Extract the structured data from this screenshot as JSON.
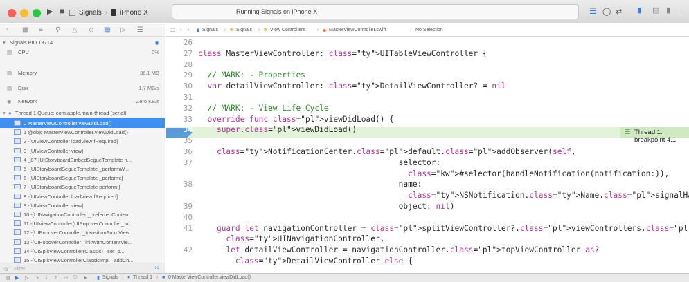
{
  "toolbar": {
    "scheme": "Signals",
    "device": "iPhone X",
    "status": "Running Signals on iPhone X"
  },
  "debug_navigator": {
    "app_name": "Signals PID 13714",
    "gauges": [
      {
        "label": "CPU",
        "value": "0%"
      },
      {
        "label": "Memory",
        "value": "36.1 MB"
      },
      {
        "label": "Disk",
        "value": "1.7 MB/s"
      },
      {
        "label": "Network",
        "value": "Zero KB/s"
      }
    ],
    "thread_label": "Thread 1 Queue: com.apple.main-thread (serial)",
    "frames": [
      "0 MasterViewController.viewDidLoad()",
      "1 @objc MasterViewController.viewDidLoad()",
      "2 -[UIViewController loadViewIfRequired]",
      "3 -[UIViewController view]",
      "4 _87-[UIStoryboardEmbedSegueTemplate n...",
      "5 -[UIStoryboardSegueTemplate _performW...",
      "6 -[UIStoryboardSegueTemplate _perform:]",
      "7 -[UIStoryboardSegueTemplate perform:]",
      "8 -[UIViewController loadViewIfRequired]",
      "9 -[UIViewController view]",
      "10 -[UINavigationController _preferredContent...",
      "11 -[UIViewController(UIPopoverController_Int...",
      "12 -[UIPopoverController _transitionFromView...",
      "13 -[UIPopoverController _initWithContentVie...",
      "14 -[UISplitViewController(Classic) _set_p...",
      "15 -[UISplitViewControllerClassicImpl _addCh..."
    ],
    "filter_placeholder": "Filter"
  },
  "jumpbar": [
    "Signals",
    "Signals",
    "View Controllers",
    "MasterViewController.swift",
    "No Selection"
  ],
  "code_lines": [
    {
      "n": "26",
      "t": ""
    },
    {
      "n": "27",
      "t": "class MasterViewController: UITableViewController {"
    },
    {
      "n": "28",
      "t": ""
    },
    {
      "n": "29",
      "t": "  // MARK: - Properties"
    },
    {
      "n": "30",
      "t": "  var detailViewController: DetailViewController? = nil"
    },
    {
      "n": "31",
      "t": ""
    },
    {
      "n": "32",
      "t": "  // MARK: - View Life Cycle"
    },
    {
      "n": "33",
      "t": "  override func viewDidLoad() {"
    },
    {
      "n": "34",
      "t": "    super.viewDidLoad()"
    },
    {
      "n": "35",
      "t": ""
    },
    {
      "n": "36",
      "t": "    NotificationCenter.default.addObserver(self,"
    },
    {
      "n": "37",
      "t": "                                           selector:"
    },
    {
      "n": "",
      "t": "                                             #selector(handleNotification(notification:)),"
    },
    {
      "n": "38",
      "t": "                                           name:"
    },
    {
      "n": "",
      "t": "                                             NSNotification.Name.signalHandlerCountUpdated,"
    },
    {
      "n": "39",
      "t": "                                           object: nil)"
    },
    {
      "n": "40",
      "t": ""
    },
    {
      "n": "41",
      "t": "    guard let navigationController = splitViewController?.viewControllers.last as?"
    },
    {
      "n": "",
      "t": "      UINavigationController,"
    },
    {
      "n": "42",
      "t": "      let detailViewController = navigationController.topViewController as?"
    },
    {
      "n": "",
      "t": "        DetailViewController else {"
    }
  ],
  "breakpoint": {
    "line": "34",
    "label": "Thread 1: breakpoint 4.1"
  },
  "debug_bar": {
    "breadcrumb": [
      "Signals",
      "Thread 1",
      "0 MasterViewController.viewDidLoad()"
    ]
  }
}
